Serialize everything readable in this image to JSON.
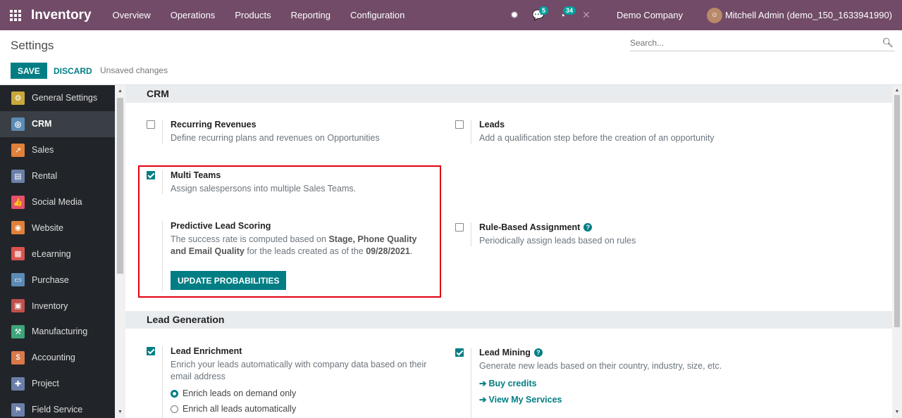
{
  "navbar": {
    "app_name": "Inventory",
    "menu": [
      "Overview",
      "Operations",
      "Products",
      "Reporting",
      "Configuration"
    ],
    "messages_count": "5",
    "activities_count": "34",
    "company": "Demo Company",
    "user": "Mitchell Admin (demo_150_1633941990)"
  },
  "control_panel": {
    "title": "Settings",
    "search_placeholder": "Search...",
    "save_label": "SAVE",
    "discard_label": "DISCARD",
    "status": "Unsaved changes"
  },
  "sidebar": {
    "items": [
      {
        "label": "General Settings",
        "color": "#C9A83B",
        "icon": "gear-icon",
        "glyph": "⚙"
      },
      {
        "label": "CRM",
        "color": "#5C8BB5",
        "icon": "crm-icon",
        "glyph": "◎"
      },
      {
        "label": "Sales",
        "color": "#E0803A",
        "icon": "sales-icon",
        "glyph": "↗"
      },
      {
        "label": "Rental",
        "color": "#6B7FA8",
        "icon": "rental-icon",
        "glyph": "▤"
      },
      {
        "label": "Social Media",
        "color": "#E5506B",
        "icon": "social-media-icon",
        "glyph": "👍"
      },
      {
        "label": "Website",
        "color": "#E0803A",
        "icon": "website-icon",
        "glyph": "◉"
      },
      {
        "label": "eLearning",
        "color": "#D9534F",
        "icon": "elearning-icon",
        "glyph": "▦"
      },
      {
        "label": "Purchase",
        "color": "#5C8BB5",
        "icon": "purchase-icon",
        "glyph": "▭"
      },
      {
        "label": "Inventory",
        "color": "#C0504D",
        "icon": "inventory-icon",
        "glyph": "▣"
      },
      {
        "label": "Manufacturing",
        "color": "#3FA47A",
        "icon": "manufacturing-icon",
        "glyph": "⚒"
      },
      {
        "label": "Accounting",
        "color": "#D9784A",
        "icon": "accounting-icon",
        "glyph": "$"
      },
      {
        "label": "Project",
        "color": "#6B7FA8",
        "icon": "project-icon",
        "glyph": "✚"
      },
      {
        "label": "Field Service",
        "color": "#6B7FA8",
        "icon": "field-service-icon",
        "glyph": "⚑"
      }
    ],
    "active_index": 1
  },
  "crm": {
    "section_title": "CRM",
    "recurring": {
      "title": "Recurring Revenues",
      "desc": "Define recurring plans and revenues on Opportunities",
      "checked": false
    },
    "leads": {
      "title": "Leads",
      "desc": "Add a qualification step before the creation of an opportunity",
      "checked": false
    },
    "multi_teams": {
      "title": "Multi Teams",
      "desc": "Assign salespersons into multiple Sales Teams.",
      "checked": true
    },
    "predictive": {
      "title": "Predictive Lead Scoring",
      "desc_pre": "The success rate is computed based on ",
      "desc_bold1": "Stage, Phone Quality and Email Quality",
      "desc_mid": " for the leads created as of the ",
      "desc_date": "09/28/2021",
      "desc_end": ".",
      "button": "UPDATE PROBABILITIES"
    },
    "rule_based": {
      "title": "Rule-Based Assignment",
      "desc": "Periodically assign leads based on rules",
      "checked": false
    }
  },
  "lead_generation": {
    "section_title": "Lead Generation",
    "enrichment": {
      "title": "Lead Enrichment",
      "desc": "Enrich your leads automatically with company data based on their email address",
      "checked": true,
      "option_on_demand": "Enrich leads on demand only",
      "option_auto": "Enrich all leads automatically"
    },
    "mining": {
      "title": "Lead Mining",
      "desc": "Generate new leads based on their country, industry, size, etc.",
      "checked": true,
      "link_buy": "Buy credits",
      "link_services": "View My Services"
    }
  }
}
